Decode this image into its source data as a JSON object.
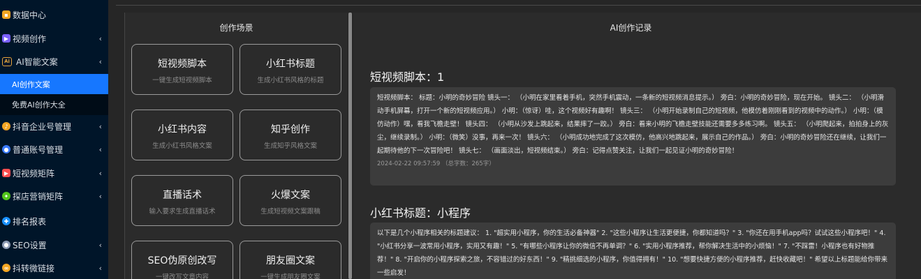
{
  "sidebar": {
    "items": [
      {
        "label": "数据中心",
        "icon": "chart-icon",
        "color": "#f5a623",
        "chevron": ""
      },
      {
        "label": "视频创作",
        "icon": "video-icon",
        "color": "#7b61ff",
        "chevron": "‹"
      },
      {
        "label": "AI智能文案",
        "icon": "ai-icon",
        "color": "#e8a33d",
        "chevron": "‹"
      },
      {
        "label": "AI创作文案",
        "icon": "",
        "color": "",
        "chevron": ""
      },
      {
        "label": "免费AI创作大全",
        "icon": "",
        "color": "",
        "chevron": ""
      },
      {
        "label": "抖音企业号管理",
        "icon": "douyin-icon",
        "color": "#f5a623",
        "chevron": "‹"
      },
      {
        "label": "普通账号管理",
        "icon": "account-icon",
        "color": "#3a7bff",
        "chevron": "‹"
      },
      {
        "label": "短视频矩阵",
        "icon": "matrix-icon",
        "color": "#ff4d4f",
        "chevron": "‹"
      },
      {
        "label": "探店营销矩阵",
        "icon": "store-icon",
        "color": "#52c41a",
        "chevron": "‹"
      },
      {
        "label": "排名报表",
        "icon": "report-icon",
        "color": "#1890ff",
        "chevron": ""
      },
      {
        "label": "SEO设置",
        "icon": "seo-icon",
        "color": "#8c9bb5",
        "chevron": "‹"
      },
      {
        "label": "抖转微链接",
        "icon": "link-icon",
        "color": "#f5a623",
        "chevron": "‹"
      }
    ]
  },
  "scene_panel": {
    "title": "创作场景",
    "cards": [
      {
        "title": "短视频脚本",
        "desc": "一键生成短视频脚本"
      },
      {
        "title": "小红书标题",
        "desc": "生成小红书风格的标题"
      },
      {
        "title": "小红书内容",
        "desc": "生成小红书风格文案"
      },
      {
        "title": "知乎创作",
        "desc": "生成知乎风格文案"
      },
      {
        "title": "直播话术",
        "desc": "输入要求生成直播话术"
      },
      {
        "title": "火爆文案",
        "desc": "生成短视频文案跟稿"
      },
      {
        "title": "SEO伪原创改写",
        "desc": "一键改写文章内容"
      },
      {
        "title": "朋友圈文案",
        "desc": "一键生成朋友圈文案"
      }
    ]
  },
  "record_panel": {
    "title": "AI创作记录",
    "records": [
      {
        "heading": "短视频脚本：1",
        "text": "短视频脚本： 标题：小明的奇妙冒险 镜头一： （小明在家里看着手机，突然手机震动，一条新的短视频消息提示。） 旁白：小明的奇妙冒险，现在开始。 镜头二： （小明滑动手机屏幕，打开一个新的短视频应用。） 小明：（惊讶）哇，这个视频好有趣啊！ 镜头三： （小明开始录制自己的短视频，他模仿着刚刚看到的视频中的动作。） 小明：（模仿动作）嘿，看我飞檐走壁！ 镜头四： （小明从沙发上跳起来，结果摔了一跤。） 旁白：看来小明的飞檐走壁技能还需要多多练习啊。 镜头五： （小明爬起来，拍拍身上的灰尘，继续录制。） 小明：（微笑）没事，再来一次！ 镜头六： （小明成功地完成了这次模仿，他高兴地跳起来，展示自己的作品。） 旁白：小明的奇妙冒险还在继续，让我们一起期待他的下一次冒险吧！ 镜头七： （画面淡出，短视频结束。） 旁白：记得点赞关注，让我们一起见证小明的奇妙冒险！",
        "meta": "2024-02-22 09:57:59 （总字数：265字）"
      },
      {
        "heading": "小红书标题：小程序",
        "text": "以下是几个小程序相关的标题建议： 1. \"超实用小程序，你的生活必备神器\" 2. \"这些小程序让生活更便捷，你都知道吗？\" 3. \"你还在用手机app吗？试试这些小程序吧！\" 4. \"小红书分享一波常用小程序，实用又有趣！\" 5. \"有哪些小程序让你的微信不再单调？\" 6. \"实用小程序推荐，帮你解决生活中的小烦恼！\" 7. \"不踩雷！小程序也有好物推荐！\" 8. \"开启你的小程序探索之旅，不容错过的好东西！\" 9. \"精挑细选的小程序，你值得拥有！\" 10. \"想要快捷方便的小程序推荐，赶快收藏吧！\" 希望以上标题能给你带来一些启发！",
        "meta": ""
      }
    ]
  }
}
